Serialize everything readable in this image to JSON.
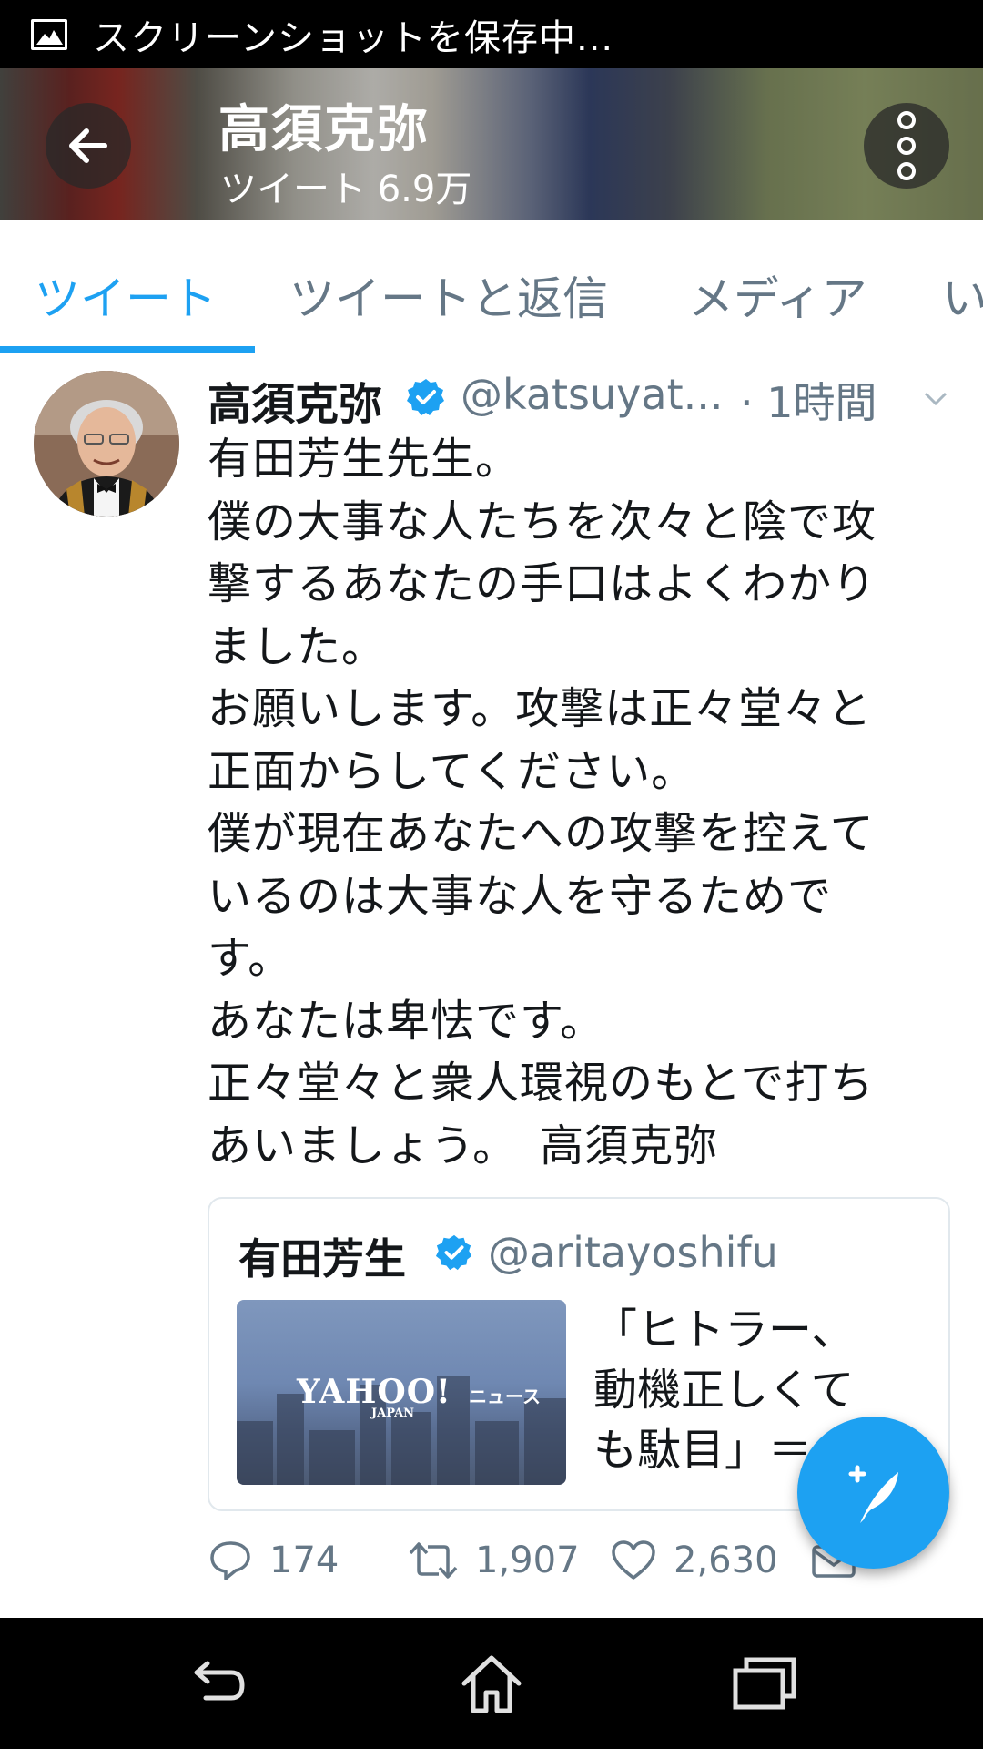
{
  "status_bar": {
    "text": "スクリーンショットを保存中..."
  },
  "header": {
    "name": "高須克弥",
    "tweet_count": "ツイート 6.9万"
  },
  "tabs": [
    {
      "label": "ツイート",
      "active": true
    },
    {
      "label": "ツイートと返信",
      "active": false
    },
    {
      "label": "メディア",
      "active": false
    },
    {
      "label": "い",
      "active": false
    }
  ],
  "tweet": {
    "author": "高須克弥",
    "handle": "@katsuyat...",
    "time": "· 1時間",
    "body": "有田芳生先生。\n僕の大事な人たちを次々と陰で攻\n撃するあなたの手口はよくわかり\nました。\nお願いします。攻撃は正々堂々と\n正面からしてください。\n僕が現在あなたへの攻撃を控えて\nいるのは大事な人を守るためで\nす。\nあなたは卑怯です。\n正々堂々と衆人環視のもとで打ち\nあいましょう。　高須克弥",
    "quote": {
      "author": "有田芳生",
      "handle": "@aritayoshifu",
      "text": "「ヒトラー、\n動機正しくて\nも駄目」＝",
      "thumb_logo": "YAHOO!",
      "thumb_logo_sub": "JAPAN",
      "thumb_news": "ニュース"
    },
    "actions": {
      "replies": "174",
      "retweets": "1,907",
      "likes": "2,630"
    }
  },
  "colors": {
    "accent": "#1da1f2",
    "muted": "#657786",
    "text": "#14171a"
  },
  "icons": [
    "image-icon",
    "back-arrow-icon",
    "more-vertical-icon",
    "verified-icon",
    "chevron-down-icon",
    "reply-icon",
    "retweet-icon",
    "like-icon",
    "dm-icon",
    "compose-icon",
    "nav-back-icon",
    "nav-home-icon",
    "nav-recents-icon"
  ]
}
